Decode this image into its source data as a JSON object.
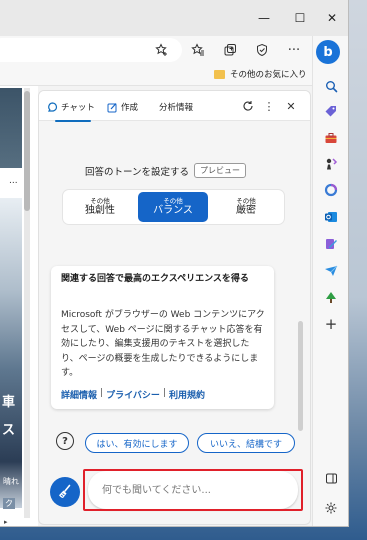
{
  "titlebar": {
    "minimize_glyph": "—",
    "maximize_glyph": "☐",
    "close_glyph": "✕"
  },
  "toolbar": {
    "more_glyph": "···"
  },
  "favorites": {
    "other_favorites": "その他のお気に入り"
  },
  "chat": {
    "tabs": [
      "チャット",
      "作成",
      "分析情報"
    ],
    "tone_label": "回答のトーンを設定する",
    "preview_badge": "プレビュー",
    "tones": [
      {
        "small": "その他",
        "big": "独創性",
        "selected": false
      },
      {
        "small": "その他",
        "big": "バランス",
        "selected": true
      },
      {
        "small": "その他",
        "big": "厳密",
        "selected": false
      }
    ],
    "card": {
      "title": "関連する回答で最高のエクスペリエンスを得る",
      "body": "Microsoft がブラウザーの Web コンテンツにアクセスして、Web ページに関するチャット応答を有効にしたり、編集支援用のテキストを選択したり、ページの概要を生成したりできるようにします。",
      "links": [
        "詳細情報",
        "プライバシー",
        "利用規約"
      ],
      "link_separator": "|"
    },
    "help_glyph": "?",
    "buttons": {
      "yes": "はい、有効にします",
      "no": "いいえ、結構です"
    },
    "input_placeholder": "何でも聞いてください..."
  },
  "page_fragments": {
    "dots": "...",
    "line1": "車",
    "line2": "ス",
    "line3": "晴れ",
    "line4": "ク",
    "line5": "▸"
  },
  "colors": {
    "accent": "#1565c8",
    "highlight_outline": "#e0202a",
    "link": "#1b5fae"
  },
  "icons": {
    "sidebar": [
      "bing-icon",
      "search-icon",
      "tag-icon",
      "toolbox-icon",
      "chess-icon",
      "circle-icon",
      "outlook-icon",
      "edit-icon",
      "send-icon",
      "tree-icon",
      "plus-icon",
      "sidebar-toggle-icon",
      "settings-icon"
    ]
  }
}
